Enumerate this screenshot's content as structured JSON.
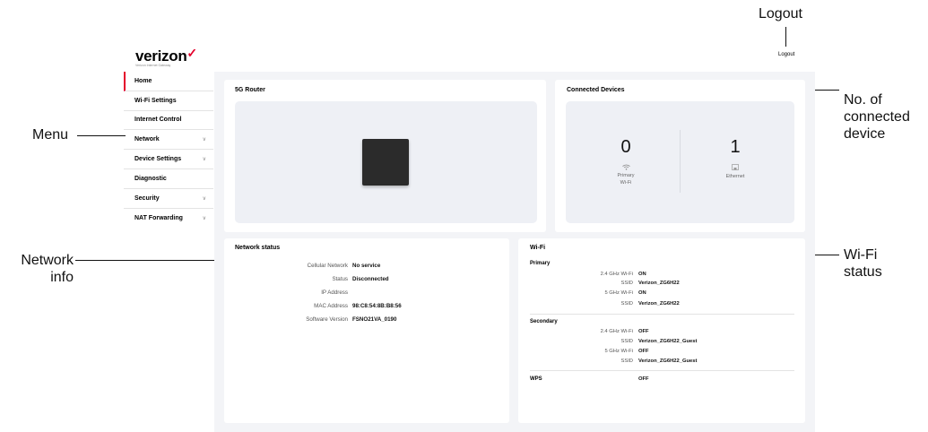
{
  "annotations": {
    "logout": "Logout",
    "menu": "Menu",
    "network_info": "Network info",
    "connected": "No. of connected device",
    "wifi_status": "Wi-Fi status"
  },
  "header": {
    "logo": "verizon",
    "logo_tagline": "Verizon Internet Gateway",
    "logout": "Logout",
    "accent": "#e4002b"
  },
  "sidebar": {
    "items": [
      {
        "label": "Home",
        "expandable": false,
        "active": true
      },
      {
        "label": "Wi-Fi Settings",
        "expandable": false
      },
      {
        "label": "Internet Control",
        "expandable": false
      },
      {
        "label": "Network",
        "expandable": true
      },
      {
        "label": "Device Settings",
        "expandable": true
      },
      {
        "label": "Diagnostic",
        "expandable": false
      },
      {
        "label": "Security",
        "expandable": true
      },
      {
        "label": "NAT Forwarding",
        "expandable": true
      }
    ]
  },
  "router_card": {
    "title": "5G Router"
  },
  "devices_card": {
    "title": "Connected Devices",
    "wifi": {
      "count": "0",
      "label_line1": "Primary",
      "label_line2": "Wi-Fi",
      "icon": "wifi-icon"
    },
    "ethernet": {
      "count": "1",
      "label": "Ethernet",
      "icon": "ethernet-icon"
    }
  },
  "network_status": {
    "title": "Network status",
    "rows": [
      {
        "label": "Cellular Network",
        "value": "No service"
      },
      {
        "label": "Status",
        "value": "Disconnected"
      },
      {
        "label": "IP Address",
        "value": ""
      },
      {
        "label": "MAC Address",
        "value": "98:C8:54:8B:B8:56"
      },
      {
        "label": "Software Version",
        "value": "FSNO21VA_0190"
      }
    ]
  },
  "wifi": {
    "title": "Wi-Fi",
    "primary": {
      "heading": "Primary",
      "rows": [
        {
          "label": "2.4 GHz Wi-Fi",
          "value": "ON"
        },
        {
          "label": "SSID",
          "value": "Verizon_ZG6H22"
        },
        {
          "label": "5 GHz Wi-Fi",
          "value": "ON"
        },
        {
          "label": "SSID",
          "value": "Verizon_ZG6H22"
        }
      ]
    },
    "secondary": {
      "heading": "Secondary",
      "rows": [
        {
          "label": "2.4 GHz Wi-Fi",
          "value": "OFF"
        },
        {
          "label": "SSID",
          "value": "Verizon_ZG6H22_Guest"
        },
        {
          "label": "5 GHz Wi-Fi",
          "value": "OFF"
        },
        {
          "label": "SSID",
          "value": "Verizon_ZG6H22_Guest"
        }
      ]
    },
    "wps": {
      "label": "WPS",
      "value": "OFF"
    }
  }
}
